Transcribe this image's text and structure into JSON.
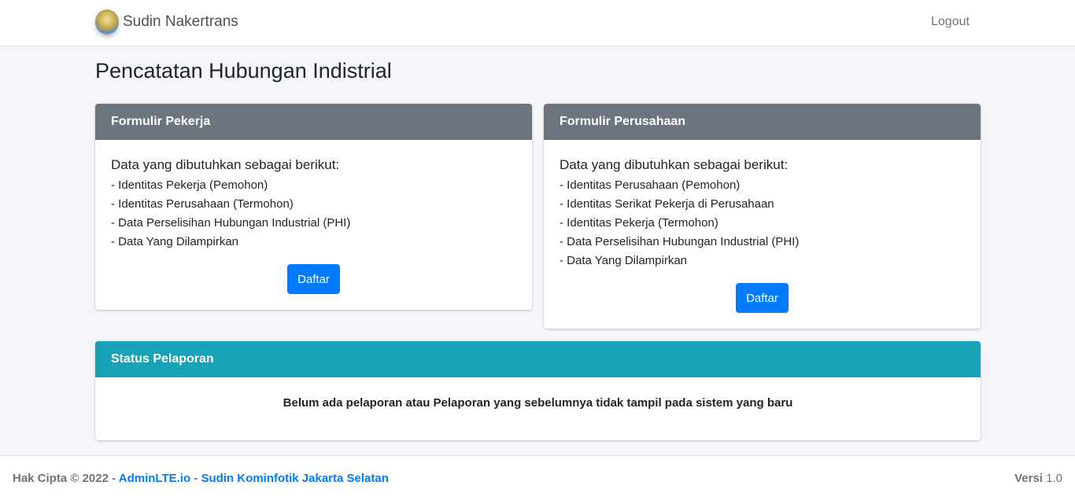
{
  "navbar": {
    "brand": "Sudin Nakertrans",
    "logout": "Logout"
  },
  "page": {
    "title": "Pencatatan Hubungan Indistrial"
  },
  "pekerja": {
    "header": "Formulir Pekerja",
    "intro": "Data yang dibutuhkan sebagai berikut:",
    "items": [
      "- Identitas Pekerja (Pemohon)",
      "- Identitas Perusahaan (Termohon)",
      "- Data Perselisihan Hubungan Industrial (PHI)",
      "- Data Yang Dilampirkan"
    ],
    "button": "Daftar"
  },
  "perusahaan": {
    "header": "Formulir Perusahaan",
    "intro": "Data yang dibutuhkan sebagai berikut:",
    "items": [
      "- Identitas Perusahaan (Pemohon)",
      "- Identitas Serikat Pekerja di Perusahaan",
      "- Identitas Pekerja (Termohon)",
      "- Data Perselisihan Hubungan Industrial (PHI)",
      "- Data Yang Dilampirkan"
    ],
    "button": "Daftar"
  },
  "status": {
    "header": "Status Pelaporan",
    "message": "Belum ada pelaporan atau Pelaporan yang sebelumnya tidak tampil pada sistem yang baru"
  },
  "footer": {
    "copyright": "Hak Cipta © 2022 -",
    "link1": "AdminLTE.io",
    "separator": "-",
    "link2": "Sudin Kominfotik Jakarta Selatan",
    "version_label": "Versi",
    "version_value": "1.0"
  },
  "colors": {
    "primary": "#007bff",
    "secondary": "#6c757d",
    "info": "#17a2b8",
    "background": "#f4f6f9"
  }
}
